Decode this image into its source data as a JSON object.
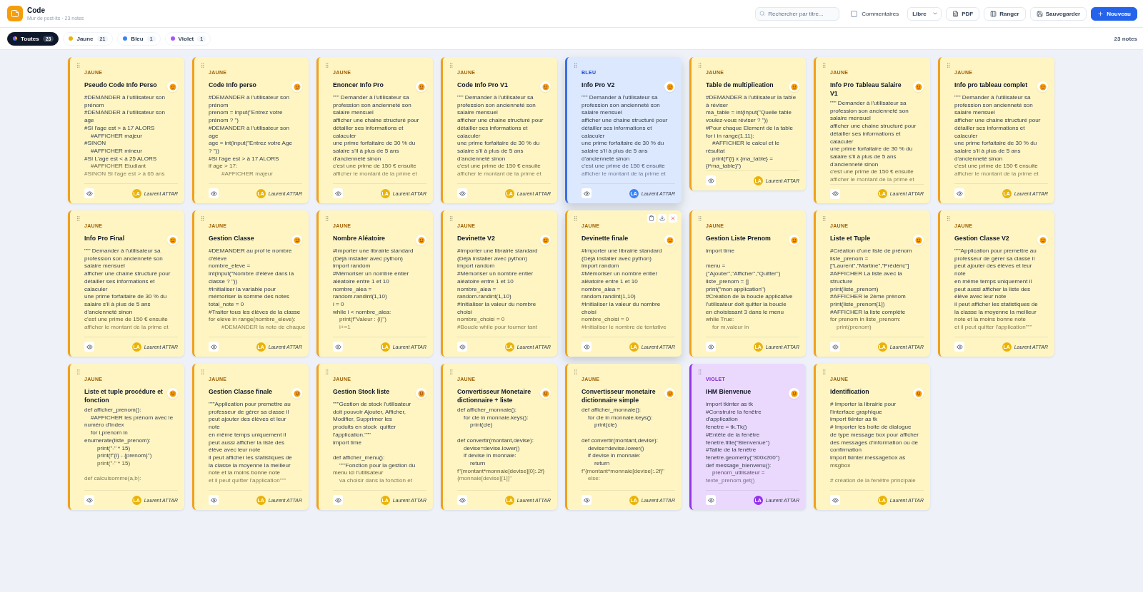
{
  "app": {
    "title": "Code",
    "subtitle": "Mur de post-its · 23 notes"
  },
  "toolbar": {
    "search": {
      "placeholder": "Rechercher par titre..."
    },
    "comments": {
      "label": "Commentaires",
      "checked": false
    },
    "layout_select": {
      "value": "Libre"
    },
    "buttons": [
      {
        "label": "PDF",
        "kind": "pdf"
      },
      {
        "label": "Ranger",
        "kind": "arrange"
      },
      {
        "label": "Sauvegarder",
        "kind": "save"
      },
      {
        "label": "Nouveau",
        "kind": "new"
      }
    ]
  },
  "filters": [
    {
      "label": "Toutes",
      "count": "23",
      "selected": true
    },
    {
      "label": "Jaune",
      "count": "21",
      "selected": false,
      "color": "#eab308"
    },
    {
      "label": "Bleu",
      "count": "1",
      "selected": false,
      "color": "#3b82f6"
    },
    {
      "label": "Violet",
      "count": "1",
      "selected": false,
      "color": "#a855f7"
    }
  ],
  "note_count": "23 notes",
  "notes": [
    {
      "tag": "JAUNE",
      "kind": "yellow",
      "title": "Pseudo Code Info Perso",
      "hovered": false,
      "actions_visible": false,
      "truncated": true,
      "author_initials": "LA",
      "author": "Laurent ATTAR",
      "blocks": [
        [
          "#DEMANDER à l'utilisateur son",
          "prénom",
          "#DEMANDER à l'utilisateur son",
          "age",
          "#SI l'age est > à 17 ALORS",
          "    #AFFICHER majeur",
          "#SINON",
          "    #AFFICHER mineur",
          "#SI L'age est < à 25 ALORS",
          "    #AFFICHER Etudiant",
          "#SINON SI l'age est > à 65 ans"
        ]
      ]
    },
    {
      "tag": "JAUNE",
      "kind": "yellow",
      "title": "Code Info perso",
      "hovered": false,
      "actions_visible": false,
      "truncated": true,
      "author_initials": "LA",
      "author": "Laurent ATTAR",
      "blocks": [
        [
          "#DEMANDER à l'utilisateur son",
          "prénom",
          "prenom = input(\"Entrez votre",
          "prénom ? \")",
          "#DEMANDER à l'utilisateur son",
          "age",
          "age = int(input(\"Entrez votre Age",
          "? \"))",
          "#SI l'age est > à 17 ALORS",
          "if age > 17:",
          "        #AFFICHER majeur"
        ]
      ]
    },
    {
      "tag": "JAUNE",
      "kind": "yellow",
      "title": "Enoncer Info Pro",
      "hovered": false,
      "actions_visible": false,
      "truncated": true,
      "author_initials": "LA",
      "author": "Laurent ATTAR",
      "blocks": [
        [
          "\"\"\" Demander à l'utilisateur sa",
          "profession son ancienneté son",
          "salaire mensuel",
          "afficher une chaine structuré pour",
          "détailler ses informations et",
          "calaculer",
          "une prime forfaitaire de 30 % du",
          "salaire s'il à plus de 5 ans",
          "d'ancienneté sinon",
          "c'est une prime de 150 € ensuite",
          "afficher le montant de la prime et"
        ]
      ]
    },
    {
      "tag": "JAUNE",
      "kind": "yellow",
      "title": "Code Info Pro V1",
      "hovered": false,
      "actions_visible": false,
      "truncated": true,
      "author_initials": "LA",
      "author": "Laurent ATTAR",
      "blocks": [
        [
          "\"\"\" Demander à l'utilisateur sa",
          "profession son ancienneté son",
          "salaire mensuel",
          "afficher une chaine structuré pour",
          "détailler ses informations et",
          "calaculer",
          "une prime forfaitaire de 30 % du",
          "salaire s'il à plus de 5 ans",
          "d'ancienneté sinon",
          "c'est une prime de 150 € ensuite",
          "afficher le montant de la prime et"
        ]
      ]
    },
    {
      "tag": "BLEU",
      "kind": "blue",
      "title": "Info Pro V2",
      "hovered": true,
      "actions_visible": false,
      "truncated": true,
      "author_initials": "LA",
      "author": "Laurent ATTAR",
      "blocks": [
        [
          "\"\"\" Demander à l'utilisateur sa",
          "profession son ancienneté son",
          "salaire mensuel",
          "afficher une chaine structuré pour",
          "détailler ses informations et",
          "calaculer",
          "une prime forfaitaire de 30 % du",
          "salaire s'il à plus de 5 ans",
          "d'ancienneté sinon",
          "c'est une prime de 150 € ensuite",
          "afficher le montant de la prime et"
        ]
      ]
    },
    {
      "tag": "JAUNE",
      "kind": "yellow",
      "title": "Table de multiplication",
      "hovered": false,
      "actions_visible": false,
      "truncated": false,
      "author_initials": "LA",
      "author": "Laurent ATTAR",
      "blocks": [
        [
          "#DEMANDER à l'utilisateur la table",
          "à réviser",
          "ma_table = int(input(\"Quelle table",
          "voulez-vous réviser ? \"))",
          "#Pour chaque Element de la table",
          "for i in range(1,11):",
          "    #AFFICHER le calcul et le",
          "résultat",
          "    print(f\"{i} x {ma_table} =",
          "{i*ma_table}\")"
        ]
      ]
    },
    {
      "tag": "JAUNE",
      "kind": "yellow",
      "title": "Info Pro Tableau Salaire V1",
      "hovered": false,
      "actions_visible": false,
      "truncated": true,
      "author_initials": "LA",
      "author": "Laurent ATTAR",
      "blocks": [
        [
          "\"\"\" Demander à l'utilisateur sa",
          "profession son ancienneté son",
          "salaire mensuel",
          "afficher une chaine structuré pour",
          "détailler ses informations et",
          "calaculer",
          "une prime forfaitaire de 30 % du",
          "salaire s'il à plus de 5 ans",
          "d'ancienneté sinon",
          "c'est une prime de 150 € ensuite",
          "afficher le montant de la prime et"
        ]
      ]
    },
    {
      "tag": "JAUNE",
      "kind": "yellow",
      "title": "Info pro tableau complet",
      "hovered": false,
      "actions_visible": false,
      "truncated": true,
      "author_initials": "LA",
      "author": "Laurent ATTAR",
      "blocks": [
        [
          "\"\"\" Demander à l'utilisateur sa",
          "profession son ancienneté son",
          "salaire mensuel",
          "afficher une chaine structuré pour",
          "détailler ses informations et",
          "calaculer",
          "une prime forfaitaire de 30 % du",
          "salaire s'il à plus de 5 ans",
          "d'ancienneté sinon",
          "c'est une prime de 150 € ensuite",
          "afficher le montant de la prime et"
        ]
      ]
    },
    {
      "tag": "JAUNE",
      "kind": "yellow",
      "title": "Info Pro Final",
      "hovered": false,
      "actions_visible": false,
      "truncated": true,
      "author_initials": "LA",
      "author": "Laurent ATTAR",
      "blocks": [
        [
          "\"\"\" Demander à l'utilisateur sa",
          "profession son ancienneté son",
          "salaire mensuel",
          "afficher une chaine structuré pour",
          "détailler ses informations et",
          "calaculer",
          "une prime forfaitaire de 30 % du",
          "salaire s'il à plus de 5 ans",
          "d'ancienneté sinon",
          "c'est une prime de 150 € ensuite",
          "afficher le montant de la prime et"
        ]
      ]
    },
    {
      "tag": "JAUNE",
      "kind": "yellow",
      "title": "Gestion Classe",
      "hovered": false,
      "actions_visible": false,
      "truncated": true,
      "author_initials": "LA",
      "author": "Laurent ATTAR",
      "blocks": [
        [
          "#DEMANDER au prof le nombre",
          "d'élève",
          "nombre_eleve =",
          "int(input(\"Nombre d'élève dans la",
          "classe ? \"))",
          "#Initialiser la variable pour",
          "mémoriser la somme des notes",
          "total_note = 0",
          "#Traiter tous les élèves de la classe",
          "for eleve in range(nombre_eleve):",
          "        #DEMANDER la note de chaque"
        ]
      ]
    },
    {
      "tag": "JAUNE",
      "kind": "yellow",
      "title": "Nombre Aléatoire",
      "hovered": false,
      "actions_visible": false,
      "truncated": true,
      "author_initials": "LA",
      "author": "Laurent ATTAR",
      "blocks": [
        [
          "#Importer une librairie standard",
          "(Déjà installer avec python)",
          "import random",
          "#Mémoriser un nombre entier",
          "aléatoire entre 1 et 10",
          "nombre_alea =",
          "random.randint(1,10)",
          "i = 0",
          "while i < nombre_alea:",
          "    print(f\"Valeur : {i}\")",
          "    i+=1"
        ]
      ]
    },
    {
      "tag": "JAUNE",
      "kind": "yellow",
      "title": "Devinette V2",
      "hovered": false,
      "actions_visible": false,
      "truncated": true,
      "author_initials": "LA",
      "author": "Laurent ATTAR",
      "blocks": [
        [
          "#Importer une librairie standard",
          "(Déjà installer avec python)",
          "import random",
          "#Mémoriser un nombre entier",
          "aléatoire entre 1 et 10",
          "nombre_alea =",
          "random.randint(1,10)",
          "#Initialiser la valeur du nombre",
          "choisi",
          "nombre_choisi = 0",
          "#Boucle while pour tourner tant"
        ]
      ]
    },
    {
      "tag": "JAUNE",
      "kind": "yellow",
      "title": "Devinette finale",
      "hovered": true,
      "actions_visible": true,
      "truncated": true,
      "author_initials": "LA",
      "author": "Laurent ATTAR",
      "blocks": [
        [
          "#Importer une librairie standard",
          "(Déjà installer avec python)",
          "import random",
          "#Mémoriser un nombre entier",
          "aléatoire entre 1 et 10",
          "nombre_alea =",
          "random.randint(1,10)",
          "#Initialiser la valeur du nombre",
          "choisi",
          "nombre_choisi = 0",
          "#Initialiser le nombre de tentative"
        ]
      ]
    },
    {
      "tag": "JAUNE",
      "kind": "yellow",
      "title": "Gestion Liste Prenom",
      "hovered": false,
      "actions_visible": false,
      "truncated": true,
      "author_initials": "LA",
      "author": "Laurent ATTAR",
      "blocks": [
        [
          "import time"
        ],
        [
          "menu =",
          "(\"Ajouter\",\"Afficher\",\"Quitter\")",
          "liste_prenom = []",
          "print(\"mon application\")",
          "#Création de la boucle applicative",
          "l'utilisateur doit quitter la boucle",
          "en choisissant 3 dans le menu",
          "while True:",
          "    for m,valeur in"
        ]
      ]
    },
    {
      "tag": "JAUNE",
      "kind": "yellow",
      "title": "Liste et Tuple",
      "hovered": false,
      "actions_visible": false,
      "truncated": true,
      "author_initials": "LA",
      "author": "Laurent ATTAR",
      "blocks": [
        [
          "#Création d'une liste de prénom",
          "liste_prenom =",
          "[\"Laurent\",\"Martine\",\"Frédéric\"]",
          "#AFFICHER La liste avec la",
          "structure",
          "print(liste_prenom)",
          "#AFFICHER le 2ème prénom",
          "print(liste_prenom[1])",
          "#AFFICHER la liste complète",
          "for prenom in liste_prenom:",
          "    print(prenom)"
        ]
      ]
    },
    {
      "tag": "JAUNE",
      "kind": "yellow",
      "title": "Gestion Classe V2",
      "hovered": false,
      "actions_visible": false,
      "truncated": true,
      "author_initials": "LA",
      "author": "Laurent ATTAR",
      "blocks": [
        [
          "\"\"\"Application pour premettre au",
          "professeur de gérer sa classe il",
          "peut ajouter des élèves et leur",
          "note",
          "en même temps uniquement il",
          "peut aussi afficher la liste des",
          "élève avec leur note",
          "il peut afficher les statistiques de",
          "la classe la moyenne la meilleur",
          "note et la moins bonne note",
          "et il peut quitter l'application\"\"\""
        ]
      ]
    },
    {
      "tag": "JAUNE",
      "kind": "yellow",
      "title": "Liste et tuple procédure et fonction",
      "hovered": false,
      "actions_visible": false,
      "truncated": true,
      "author_initials": "LA",
      "author": "Laurent ATTAR",
      "blocks": [
        [
          "def afficher_prenom():",
          "    #AFFICHER les prénom avec le",
          "numéro d'Index",
          "    for i,prenom in",
          "enumerate(liste_prenom):",
          "        print(\"-\" * 15)",
          "        print(f\"{i} - {prenom}\")",
          "        print(\"-\" * 15)"
        ],
        [
          "def calculsomme(a,b):"
        ]
      ]
    },
    {
      "tag": "JAUNE",
      "kind": "yellow",
      "title": "Gestion Classe finale",
      "hovered": false,
      "actions_visible": false,
      "truncated": true,
      "author_initials": "LA",
      "author": "Laurent ATTAR",
      "blocks": [
        [
          "\"\"\"Application pour premettre au",
          "professeur de gérer sa classe il",
          "peut ajouter des élèves et leur",
          "note",
          "en même temps uniquement il",
          "peut aussi afficher la liste des",
          "élève avec leur note",
          "il peut afficher les statistiques de",
          "la classe la moyenne la meilleur",
          "note et la moins bonne note",
          "et il peut quitter l'application\"\"\""
        ]
      ]
    },
    {
      "tag": "JAUNE",
      "kind": "yellow",
      "title": "Gestion Stock liste",
      "hovered": false,
      "actions_visible": false,
      "truncated": true,
      "author_initials": "LA",
      "author": "Laurent ATTAR",
      "blocks": [
        [
          "\"\"\"Gestion de stock l'utilisateur",
          "doit pouvoir Ajouter, Afficher,",
          "Modifier, Supprimer les",
          "produits en stock  quitter",
          "l'application.\"\"\"",
          "import time"
        ],
        [
          "def afficher_menu():",
          "    \"\"\"Fonction pour la gestion du",
          "menu ici l'utilisateur",
          "    va choisir dans la fonction et"
        ]
      ]
    },
    {
      "tag": "JAUNE",
      "kind": "yellow",
      "title": "Convertisseur Monetaire dictionnaire + liste",
      "hovered": false,
      "actions_visible": false,
      "truncated": true,
      "author_initials": "LA",
      "author": "Laurent ATTAR",
      "blocks": [
        [
          "def afficher_monnaie():",
          "    for cle in monnaie.keys():",
          "        print(cle)"
        ],
        [
          "def convertir(montant,devise):",
          "    devise=devise.lower()",
          "    if devise in monnaie:",
          "        return",
          "f\"{montant*monnaie[devise][0]:.2f}",
          "{monnaie[devise][1]}\""
        ]
      ]
    },
    {
      "tag": "JAUNE",
      "kind": "yellow",
      "title": "Convertisseur monetaire dictionnaire simple",
      "hovered": false,
      "actions_visible": false,
      "truncated": true,
      "author_initials": "LA",
      "author": "Laurent ATTAR",
      "blocks": [
        [
          "def afficher_monnaie():",
          "    for cle in monnaie.keys():",
          "        print(cle)"
        ],
        [
          "def convertir(montant,devise):",
          "    devise=devise.lower()",
          "    if devise in monnaie:",
          "        return",
          "f\"{montant*monnaie[devise]:.2f}\"",
          "    else:"
        ]
      ]
    },
    {
      "tag": "VIOLET",
      "kind": "violet",
      "title": "IHM Bienvenue",
      "hovered": false,
      "actions_visible": false,
      "truncated": true,
      "author_initials": "LA",
      "author": "Laurent ATTAR",
      "blocks": [
        [
          "import tkinter as tk",
          "#Construire la fenêtre",
          "d'application",
          "fenetre = tk.Tk()",
          "#Entête de la fenêtre",
          "fenetre.title(\"Bienvenue\")",
          "#Taille de la fenêtre",
          "fenetre.geometry(\"300x200\")",
          "def message_bienvenu():",
          "    prenom_utilisateur =",
          "texte_prenom.get()"
        ]
      ]
    },
    {
      "tag": "JAUNE",
      "kind": "yellow",
      "title": "Identification",
      "hovered": false,
      "actions_visible": false,
      "truncated": true,
      "author_initials": "LA",
      "author": "Laurent ATTAR",
      "blocks": [
        [
          "# Importer la librairie pour",
          "l'interface graphique",
          "import tkinter as tk",
          "# Importer les boite de dialogue",
          "de type message box pour afficher",
          "des messages d'information ou de",
          "confirmation",
          "import tkinter.messagebox as",
          "msgbox"
        ],
        [
          "# création de la fenêtre principale"
        ]
      ]
    }
  ]
}
